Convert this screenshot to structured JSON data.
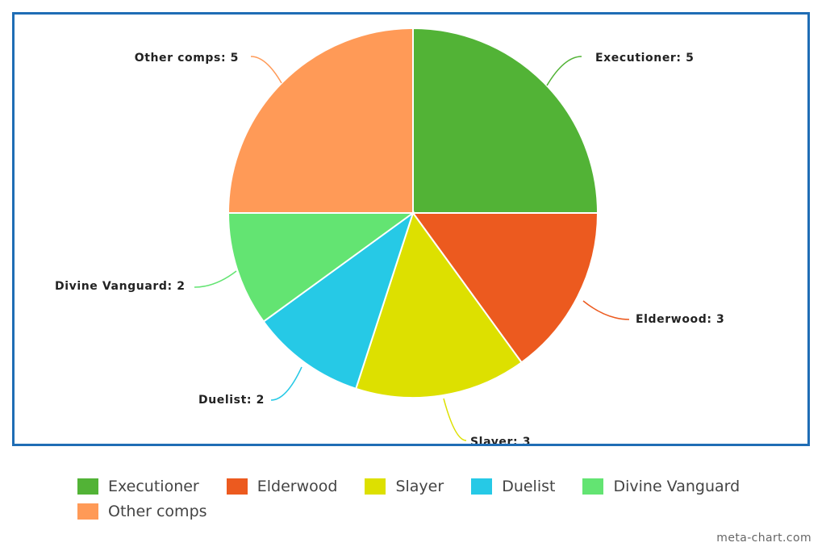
{
  "chart_data": {
    "type": "pie",
    "title": "",
    "categories": [
      "Executioner",
      "Elderwood",
      "Slayer",
      "Duelist",
      "Divine Vanguard",
      "Other comps"
    ],
    "values": [
      5,
      3,
      3,
      2,
      2,
      5
    ],
    "data_labels": [
      "Executioner: 5",
      "Elderwood: 3",
      "Slayer: 3",
      "Duelist: 2",
      "Divine Vanguard: 2",
      "Other comps: 5"
    ],
    "colors": [
      "#52b336",
      "#ec5a1f",
      "#dde000",
      "#26c9e6",
      "#63e472",
      "#ff9a57"
    ],
    "legend_position": "bottom",
    "start_angle": "12 o'clock, clockwise"
  },
  "credit": "meta-chart.com"
}
